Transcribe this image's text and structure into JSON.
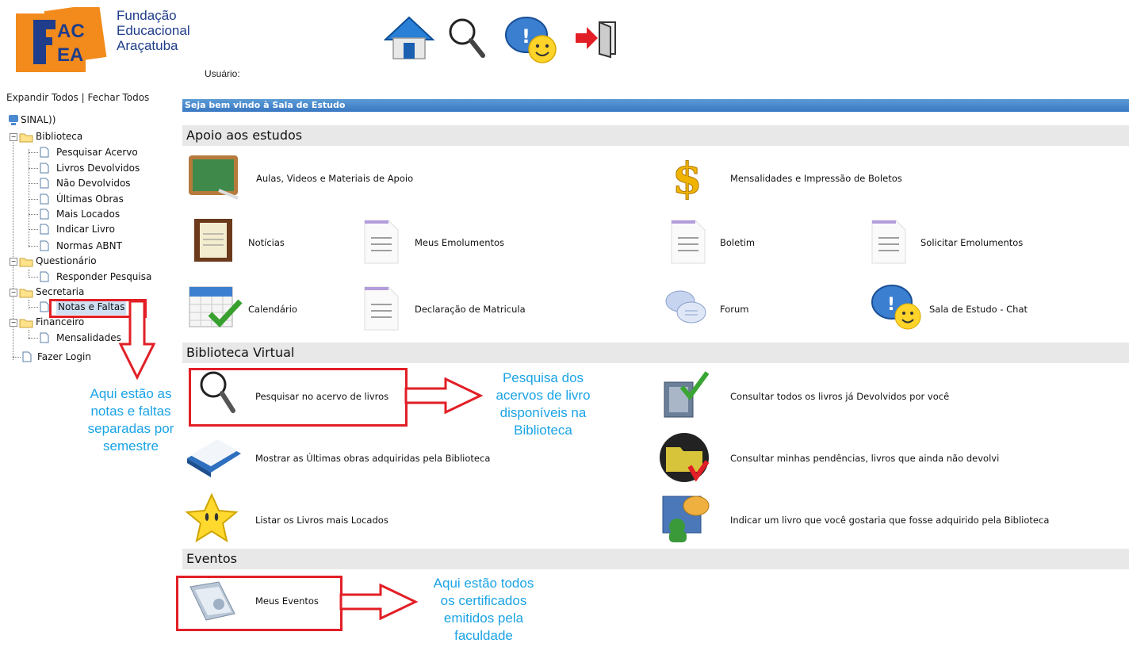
{
  "header": {
    "logo_letters": [
      "F",
      "AC",
      "EA"
    ],
    "org_name_lines": [
      "Fundação",
      "Educacional",
      "Araçatuba"
    ],
    "user_label": "Usuário:",
    "icons": [
      "home-icon",
      "search-icon",
      "chat-icon",
      "logout-icon"
    ]
  },
  "sidebar": {
    "expand_all": "Expandir Todos",
    "separator": "|",
    "close_all": "Fechar Todos",
    "root_label": "SINAL))",
    "nodes": [
      {
        "label": "Biblioteca"
      },
      {
        "label": "Pesquisar Acervo"
      },
      {
        "label": "Livros Devolvidos"
      },
      {
        "label": "Não Devolvidos"
      },
      {
        "label": "Últimas Obras"
      },
      {
        "label": "Mais Locados"
      },
      {
        "label": "Indicar Livro"
      },
      {
        "label": "Normas ABNT"
      },
      {
        "label": "Questionário"
      },
      {
        "label": "Responder Pesquisa"
      },
      {
        "label": "Secretaria"
      },
      {
        "label": "Notas e Faltas"
      },
      {
        "label": "Financeiro"
      },
      {
        "label": "Mensalidades"
      },
      {
        "label": "Fazer Login"
      }
    ]
  },
  "main": {
    "banner": "Seja bem vindo à Sala de Estudo",
    "sections": {
      "apoio": "Apoio aos estudos",
      "biblioteca": "Biblioteca Virtual",
      "eventos": "Eventos"
    },
    "apoio_items": {
      "aulas": "Aulas, Videos e Materiais de Apoio",
      "mensalidades": "Mensalidades e Impressão de Boletos",
      "noticias": "Notícias",
      "meus_emolumentos": "Meus Emolumentos",
      "boletim": "Boletim",
      "solicitar_emolumentos": "Solicitar Emolumentos",
      "calendario": "Calendário",
      "declaracao": "Declaração de Matricula",
      "forum": "Forum",
      "chat": "Sala de Estudo - Chat"
    },
    "biblioteca_items": {
      "pesquisar": "Pesquisar no acervo de livros",
      "devolvidos": "Consultar todos os livros já Devolvidos por você",
      "ultimas": "Mostrar as Últimas obras adquiridas pela Biblioteca",
      "pendencias": "Consultar minhas pendências, livros que ainda não devolvi",
      "mais_locados": "Listar os Livros mais Locados",
      "indicar": "Indicar um livro que você gostaria que fosse adquirido pela Biblioteca"
    },
    "eventos_items": {
      "meus_eventos": "Meus Eventos"
    }
  },
  "annotations": {
    "notas": [
      "Aqui estão as",
      "notas e faltas",
      "separadas por",
      "semestre"
    ],
    "pesquisa": [
      "Pesquisa dos",
      "acervos de livro",
      "disponíveis na",
      "Biblioteca"
    ],
    "eventos": [
      "Aqui estão todos",
      "os certificados",
      "emitidos pela",
      "faculdade"
    ]
  },
  "colors": {
    "annotation_red": "#e21f26",
    "annotation_blue": "#1aa3e6",
    "banner_blue": "#4a8ad0",
    "logo_orange": "#f28b1c",
    "logo_navy": "#1f3d8a"
  }
}
